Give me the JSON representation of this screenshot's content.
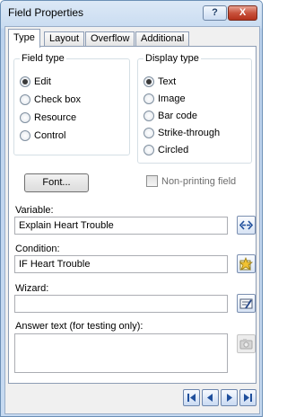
{
  "window": {
    "title": "Field Properties",
    "help_label": "?",
    "close_label": "X"
  },
  "tabs": [
    {
      "label": "Type",
      "active": true
    },
    {
      "label": "Layout",
      "active": false
    },
    {
      "label": "Overflow",
      "active": false
    },
    {
      "label": "Additional",
      "active": false
    }
  ],
  "field_type": {
    "title": "Field type",
    "options": [
      {
        "label": "Edit",
        "checked": true
      },
      {
        "label": "Check box",
        "checked": false
      },
      {
        "label": "Resource",
        "checked": false
      },
      {
        "label": "Control",
        "checked": false
      }
    ]
  },
  "display_type": {
    "title": "Display type",
    "options": [
      {
        "label": "Text",
        "checked": true
      },
      {
        "label": "Image",
        "checked": false
      },
      {
        "label": "Bar code",
        "checked": false
      },
      {
        "label": "Strike-through",
        "checked": false
      },
      {
        "label": "Circled",
        "checked": false
      }
    ]
  },
  "font_button": "Font...",
  "non_printing": {
    "label": "Non-printing field",
    "checked": false
  },
  "variable": {
    "label": "Variable:",
    "value": "Explain Heart Trouble",
    "button_icon": "double-arrow-icon"
  },
  "condition": {
    "label": "Condition:",
    "value": "IF Heart Trouble",
    "button_icon": "condition-wand-icon"
  },
  "wizard": {
    "label": "Wizard:",
    "value": "",
    "button_icon": "wizard-edit-icon"
  },
  "answer_text": {
    "label": "Answer text (for testing only):",
    "value": "",
    "button_icon": "camera-icon"
  },
  "navigation": [
    "first-record-icon",
    "previous-record-icon",
    "next-record-icon",
    "last-record-icon"
  ],
  "colors": {
    "accent": "#1f4f9c",
    "icon_yellow": "#f1c232"
  }
}
